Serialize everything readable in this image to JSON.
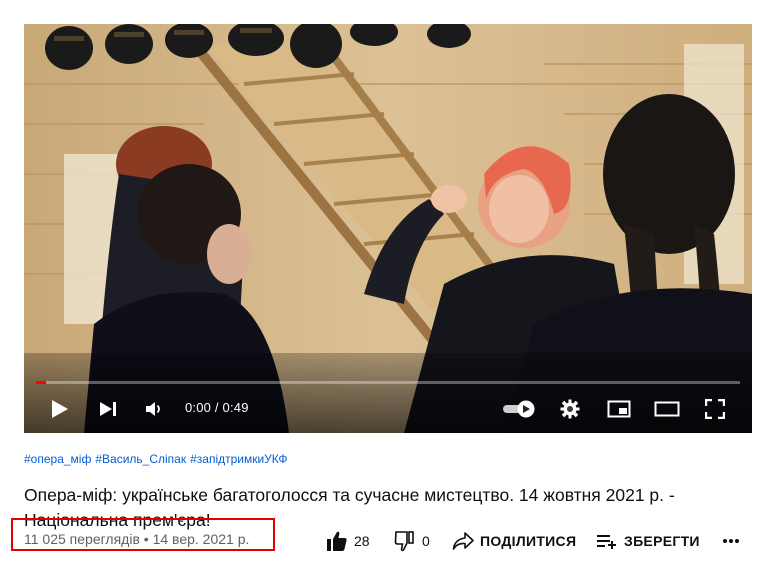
{
  "player": {
    "time_current": "0:00",
    "time_separator": " / ",
    "time_total": "0:49",
    "progress": 0.0
  },
  "video": {
    "hashtags": [
      "#опера_міф",
      "#Василь_Сліпак",
      "#запідтримкиУКФ"
    ],
    "title": "Опера-міф: українське багатоголосся та сучасне мистецтво. 14 жовтня 2021 р. - Національна прем'єра!",
    "views": "11 025 переглядів",
    "separator": "•",
    "date": "14 вер. 2021 р."
  },
  "actions": {
    "like_count": "28",
    "dislike_count": "0",
    "share_label": "ПОДІЛИТИСЯ",
    "save_label": "ЗБЕРЕГТИ"
  },
  "colors": {
    "link": "#065fd4",
    "progress": "#ff0000",
    "highlight": "#e00000",
    "meta": "#606060"
  },
  "icons": [
    "play-icon",
    "next-icon",
    "volume-icon",
    "autoplay-toggle",
    "settings-icon",
    "miniplayer-icon",
    "theater-icon",
    "fullscreen-icon",
    "like-icon",
    "dislike-icon",
    "share-icon",
    "save-playlist-icon",
    "more-icon"
  ]
}
